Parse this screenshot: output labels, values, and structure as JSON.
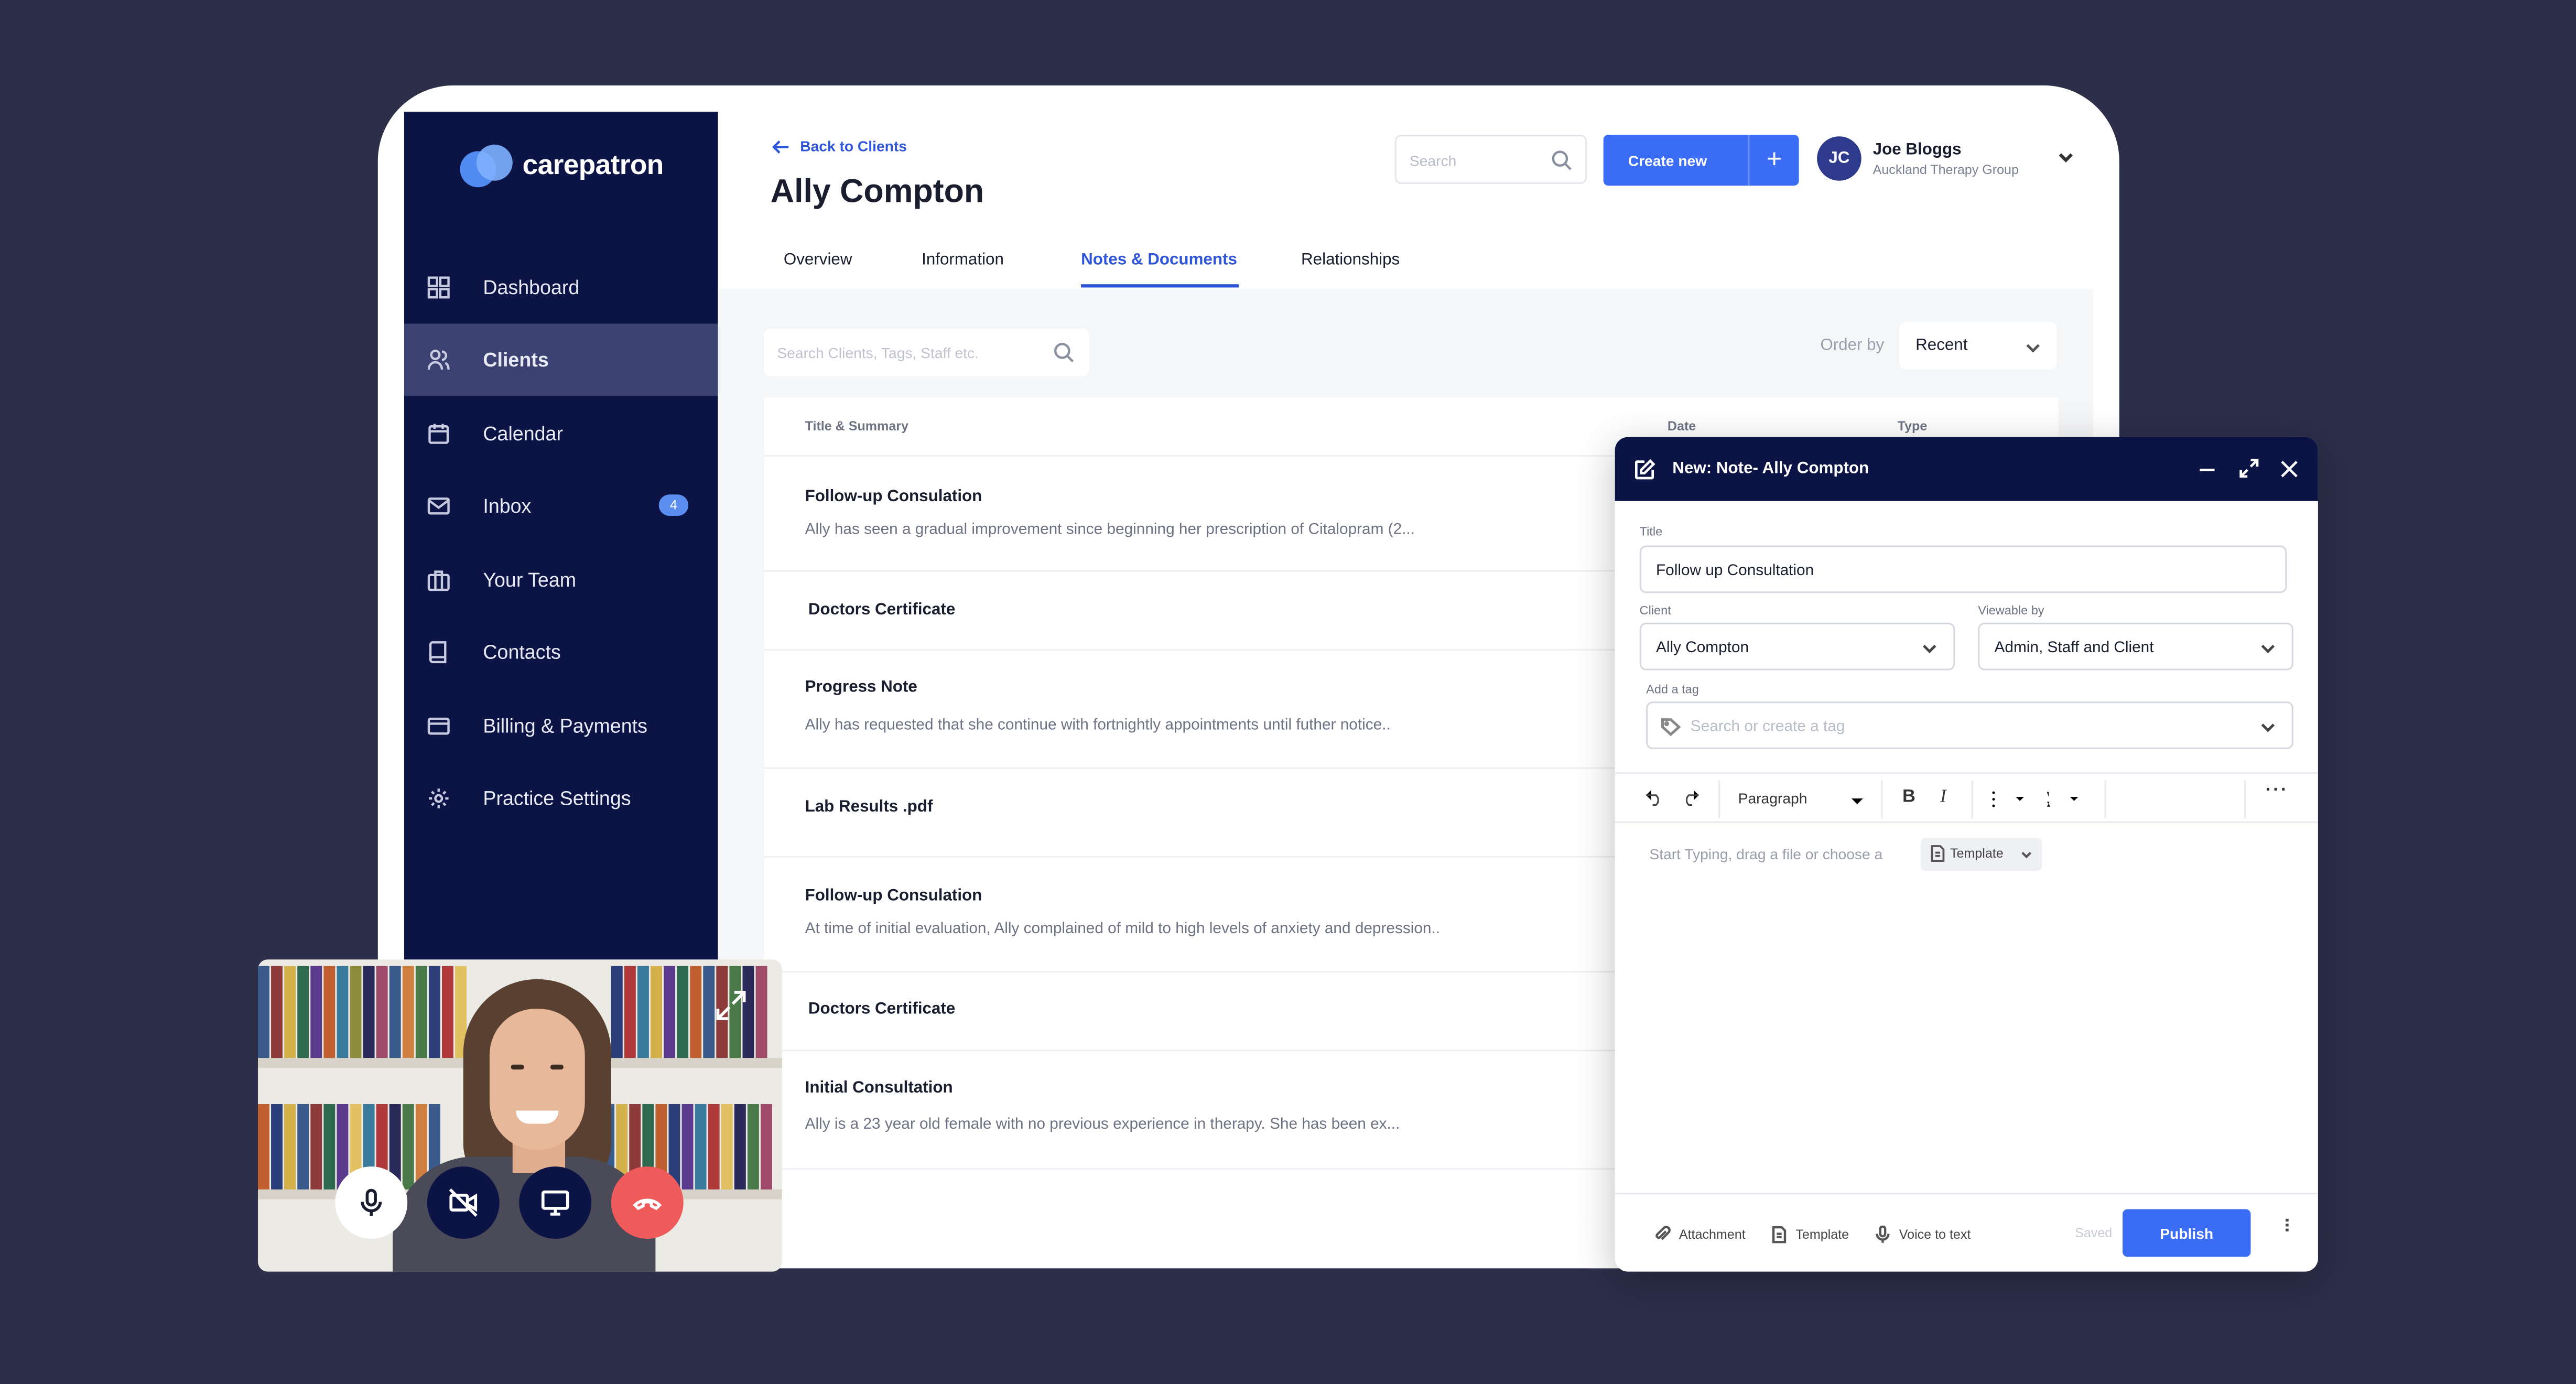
{
  "brand": {
    "name": "carepatron",
    "color_primary": "#3b6cf6",
    "color_sidebar": "#0c1445"
  },
  "sidebar": {
    "items": [
      {
        "label": "Dashboard",
        "icon": "grid-icon"
      },
      {
        "label": "Clients",
        "icon": "users-icon",
        "active": true
      },
      {
        "label": "Calendar",
        "icon": "calendar-icon"
      },
      {
        "label": "Inbox",
        "icon": "mail-icon",
        "badge": "4"
      },
      {
        "label": "Your Team",
        "icon": "briefcase-icon"
      },
      {
        "label": "Contacts",
        "icon": "book-icon"
      },
      {
        "label": "Billing & Payments",
        "icon": "card-icon"
      },
      {
        "label": "Practice Settings",
        "icon": "gear-icon"
      }
    ]
  },
  "header": {
    "back_label": "Back to Clients",
    "client_name": "Ally Compton",
    "search_placeholder": "Search",
    "create_label": "Create new",
    "user": {
      "initials": "JC",
      "name": "Joe Bloggs",
      "org": "Auckland Therapy Group"
    },
    "tabs": [
      {
        "label": "Overview"
      },
      {
        "label": "Information"
      },
      {
        "label": "Notes & Documents",
        "active": true
      },
      {
        "label": "Relationships"
      }
    ]
  },
  "notes": {
    "search_placeholder": "Search Clients, Tags, Staff etc.",
    "order_label": "Order by",
    "order_value": "Recent",
    "columns": [
      "Title & Summary",
      "Date",
      "Type"
    ],
    "rows": [
      {
        "title": "Follow-up Consulation",
        "summary": "Ally has seen a gradual improvement since beginning her prescription of Citalopram (2..."
      },
      {
        "title": "Doctors Certificate",
        "summary": ""
      },
      {
        "title": "Progress Note",
        "summary": "Ally has requested that she continue with fortnightly appointments until futher notice.."
      },
      {
        "title": "Lab Results .pdf",
        "summary": ""
      },
      {
        "title": "Follow-up Consulation",
        "summary": "At time of initial evaluation, Ally complained of mild to high levels of anxiety and depression.."
      },
      {
        "title": "Doctors Certificate",
        "summary": ""
      },
      {
        "title": "Initial Consultation",
        "summary": "Ally is a 23 year old female with no previous experience in therapy. She has been ex..."
      }
    ]
  },
  "note_editor": {
    "header_title": "New: Note-  Ally Compton",
    "title_label": "Title",
    "title_value": "Follow up Consultation",
    "client_label": "Client",
    "client_value": "Ally Compton",
    "viewable_label": "Viewable by",
    "viewable_value": "Admin, Staff and Client",
    "tag_label": "Add a tag",
    "tag_placeholder": "Search or create a tag",
    "paragraph_style": "Paragraph",
    "bold": "B",
    "italic": "I",
    "body_placeholder": "Start Typing, drag a file or choose a",
    "template_chip": "Template",
    "footer": {
      "attachment": "Attachment",
      "template": "Template",
      "voice": "Voice to text",
      "saved": "Saved",
      "publish": "Publish"
    }
  },
  "video_call": {
    "controls": [
      "mic-icon",
      "camera-off-icon",
      "screen-share-icon",
      "end-call-icon"
    ],
    "end_call_color": "#ef5a5a"
  }
}
